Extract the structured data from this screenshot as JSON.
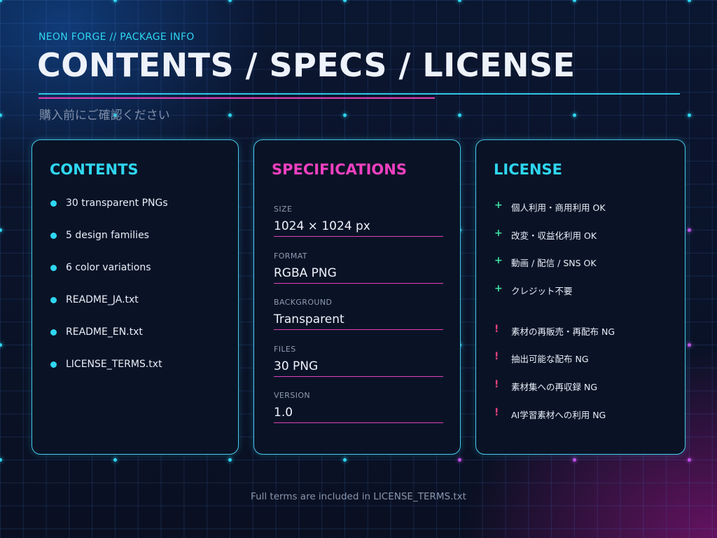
{
  "header": {
    "kicker": "NEON FORGE // PACKAGE INFO",
    "title": "CONTENTS / SPECS / LICENSE",
    "subtitle": "購入前にご確認ください"
  },
  "contents": {
    "title": "CONTENTS",
    "items": [
      "30 transparent PNGs",
      "5 design families",
      "6 color variations",
      "README_JA.txt",
      "README_EN.txt",
      "LICENSE_TERMS.txt"
    ]
  },
  "specs": {
    "title": "SPECIFICATIONS",
    "items": [
      {
        "label": "SIZE",
        "value": "1024 × 1024 px"
      },
      {
        "label": "FORMAT",
        "value": "RGBA PNG"
      },
      {
        "label": "BACKGROUND",
        "value": "Transparent"
      },
      {
        "label": "FILES",
        "value": "30 PNG"
      },
      {
        "label": "VERSION",
        "value": "1.0"
      }
    ]
  },
  "license": {
    "title": "LICENSE",
    "ok_marker": "+",
    "ng_marker": "!",
    "ok": [
      "個人利用・商用利用 OK",
      "改変・収益化利用 OK",
      "動画 / 配信 / SNS OK",
      "クレジット不要"
    ],
    "ng": [
      "素材の再販売・再配布 NG",
      "抽出可能な配布 NG",
      "素材集への再収録 NG",
      "AI学習素材への利用 NG"
    ]
  },
  "footer": {
    "text": "Full terms are included in LICENSE_TERMS.txt"
  },
  "colors": {
    "accent_cyan": "#2fd6f0",
    "accent_pink": "#e040b8",
    "ok_green": "#3de0a0",
    "ng_red": "#f0407a"
  }
}
